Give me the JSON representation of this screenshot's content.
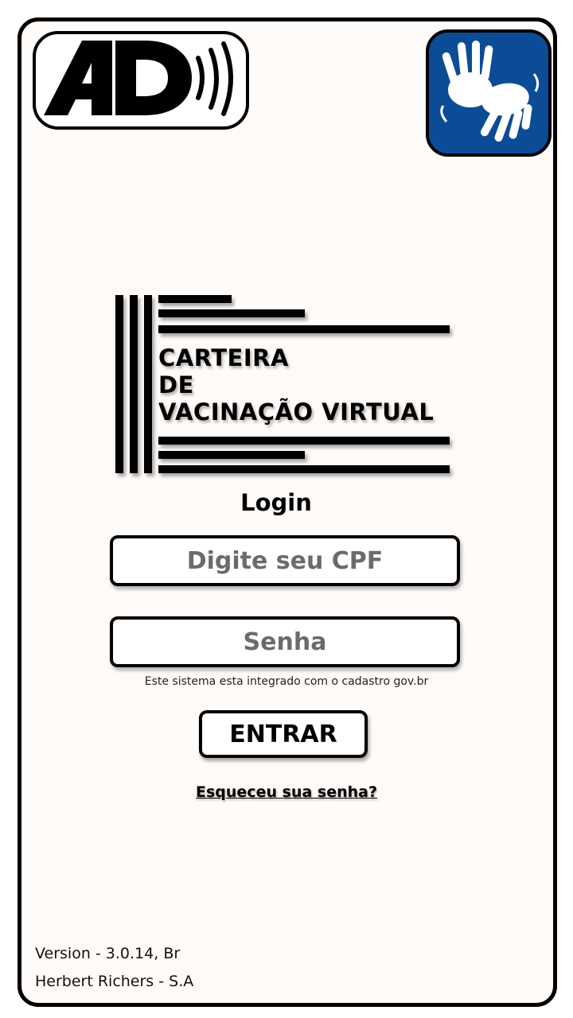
{
  "accessibility": {
    "audio_description_icon": "audio-description-icon",
    "audio_description_text": "AD",
    "sign_language_icon": "sign-language-icon",
    "sign_language_bg": "#0c4c96"
  },
  "logo": {
    "line1": "CARTEIRA",
    "line2": "DE",
    "line3": "VACINAÇÃO VIRTUAL"
  },
  "login": {
    "title": "Login",
    "cpf_placeholder": "Digite seu CPF",
    "password_placeholder": "Senha",
    "info": "Este sistema esta integrado com o cadastro gov.br",
    "enter_label": "ENTRAR",
    "forgot_label": "Esqueceu sua senha?"
  },
  "footer": {
    "version": "Version - 3.0.14, Br",
    "company": "Herbert Richers - S.A"
  }
}
